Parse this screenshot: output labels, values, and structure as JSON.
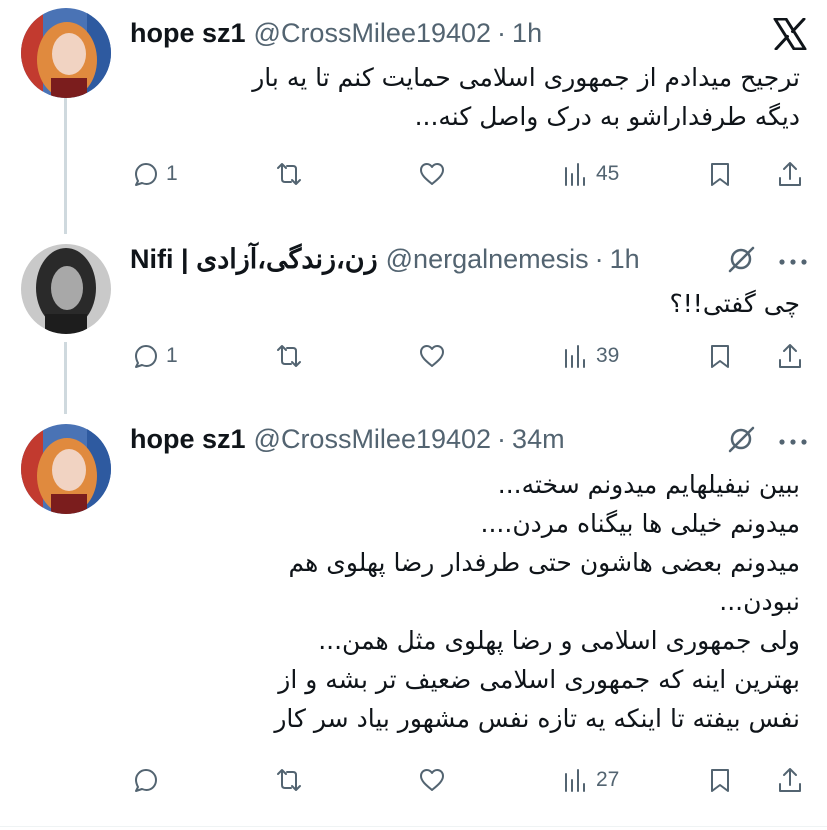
{
  "tweets": [
    {
      "name": "hope sz1",
      "handle": "@CrossMilee19402",
      "time": "1h",
      "text_lines": [
        "ترجیح میدادم از جمهوری اسلامی حمایت کنم تا یه بار",
        "دیگه طرفداراشو به درک واصل کنه..."
      ],
      "replies": "1",
      "retweets": "",
      "likes": "",
      "views": "45"
    },
    {
      "name": "Nifi | زن،زندگی،آزادی",
      "handle": "@nergalnemesis",
      "time": "1h",
      "text_lines": [
        "چی گفتی!!؟"
      ],
      "replies": "1",
      "retweets": "",
      "likes": "",
      "views": "39"
    },
    {
      "name": "hope sz1",
      "handle": "@CrossMilee19402",
      "time": "34m",
      "text_lines": [
        "ببین نیفیلهایم میدونم سخته...",
        "میدونم خیلی ها بیگناه مردن....",
        "میدونم بعضی هاشون حتی طرفدار رضا پهلوی هم",
        "نبودن...",
        "ولی جمهوری اسلامی و رضا پهلوی مثل همن...",
        "بهترین اینه که جمهوری اسلامی ضعیف تر بشه و از",
        "نفس بیفته تا اینکه یه تازه نفس مشهور بیاد سر کار"
      ],
      "replies": "",
      "retweets": "",
      "likes": "",
      "views": "27"
    }
  ],
  "icons": {
    "brand": "x-logo-icon",
    "grok": "grok-icon",
    "more": "more-options-icon"
  },
  "colors": {
    "text": "#0f1419",
    "secondary": "#536471",
    "thread_line": "#cfd9de"
  }
}
